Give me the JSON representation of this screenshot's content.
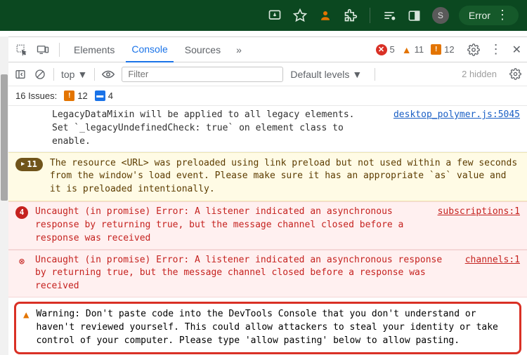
{
  "browser": {
    "avatar_initial": "S",
    "error_label": "Error"
  },
  "tabs": {
    "elements": "Elements",
    "console": "Console",
    "sources": "Sources",
    "overflow": "»"
  },
  "counts": {
    "errors": "5",
    "warnings": "11",
    "infos": "12"
  },
  "filterbar": {
    "context": "top",
    "filter_placeholder": "Filter",
    "levels": "Default levels",
    "hidden": "2 hidden"
  },
  "issues": {
    "label": "16 Issues:",
    "orange": "12",
    "blue": "4"
  },
  "logs": {
    "plain1": {
      "msg": "LegacyDataMixin will be applied to all legacy elements.\nSet `_legacyUndefinedCheck: true` on element class to enable.",
      "src": "desktop_polymer.js:5045"
    },
    "preload": {
      "count": "11",
      "msg": "The resource <URL> was preloaded using link preload but not used within a few seconds from the window's load event. Please make sure it has an appropriate `as` value and it is preloaded intentionally."
    },
    "err1": {
      "count": "4",
      "msg": "Uncaught (in promise) Error: A listener indicated an asynchronous response by returning true, but the message channel closed before a response was received",
      "src": "subscriptions:1"
    },
    "err2": {
      "msg": "Uncaught (in promise) Error: A listener indicated an asynchronous response by returning true, but the message channel closed before a response was received",
      "src": "channels:1"
    },
    "warn": {
      "msg": "Warning: Don't paste code into the DevTools Console that you don't understand or haven't reviewed yourself. This could allow attackers to steal your identity or take control of your computer. Please type 'allow pasting' below to allow pasting."
    }
  }
}
